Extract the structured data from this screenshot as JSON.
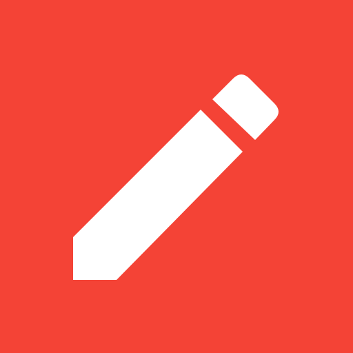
{
  "app_icon": {
    "icon": "pencil-icon",
    "background_color": "#F44336",
    "glyph_color": "#FFFFFF"
  }
}
